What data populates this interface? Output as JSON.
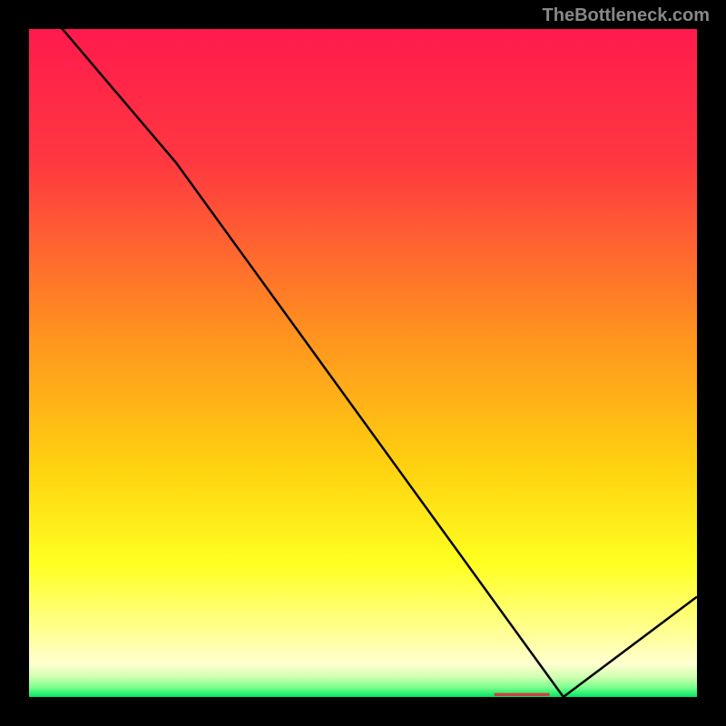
{
  "watermark": "TheBottleneck.com",
  "chart_data": {
    "type": "line",
    "title": "",
    "xlabel": "",
    "ylabel": "",
    "xlim": [
      0,
      100
    ],
    "ylim": [
      0,
      100
    ],
    "x": [
      0,
      5,
      22,
      80,
      100
    ],
    "values": [
      105,
      100,
      80,
      0,
      15
    ],
    "marker": {
      "x": 74,
      "y": 0,
      "label": "▬▬▬▬▬▬"
    },
    "background_gradient": {
      "stops": [
        {
          "pos": 0,
          "color": "#ff1a4d"
        },
        {
          "pos": 20,
          "color": "#ff3840"
        },
        {
          "pos": 45,
          "color": "#ff9020"
        },
        {
          "pos": 65,
          "color": "#ffd010"
        },
        {
          "pos": 80,
          "color": "#ffff20"
        },
        {
          "pos": 90,
          "color": "#ffff90"
        },
        {
          "pos": 95,
          "color": "#ffffd0"
        },
        {
          "pos": 97,
          "color": "#d0ffb0"
        },
        {
          "pos": 98.5,
          "color": "#80ff90"
        },
        {
          "pos": 100,
          "color": "#00e860"
        }
      ]
    }
  }
}
